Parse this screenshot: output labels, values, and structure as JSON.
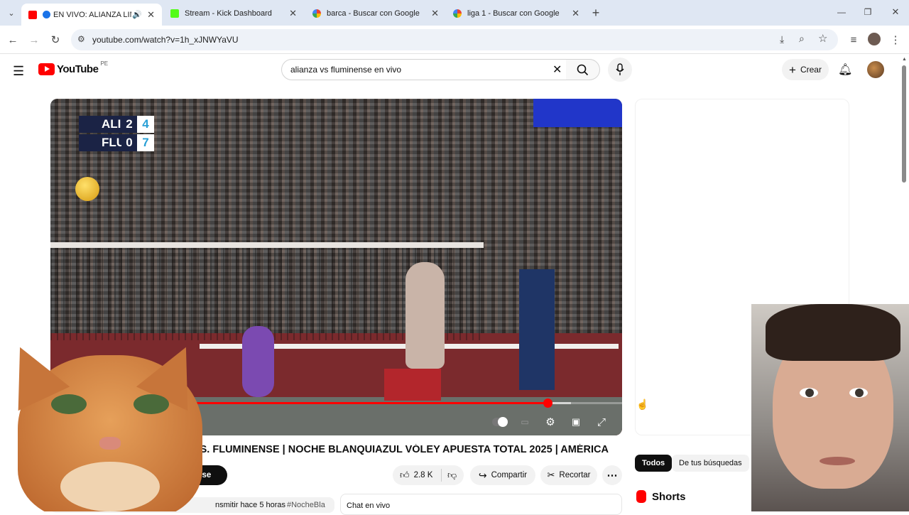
{
  "browser": {
    "tabs": [
      {
        "title": "EN VIVO: ALIANZA LIM",
        "active": true
      },
      {
        "title": "Stream - Kick Dashboard",
        "active": false
      },
      {
        "title": "barca - Buscar con Google",
        "active": false
      },
      {
        "title": "liga 1 - Buscar con Google",
        "active": false
      }
    ],
    "url": "youtube.com/watch?v=1h_xJNWYaVU",
    "new_tab_label": "+"
  },
  "youtube": {
    "logo_text": "YouTube",
    "region": "PE",
    "search_value": "alianza vs fluminense en vivo",
    "create_label": "Crear"
  },
  "player": {
    "scoreboard": [
      {
        "team": "ALI",
        "sets": "2",
        "points": "4"
      },
      {
        "team": "FLU",
        "sets": "0",
        "points": "7"
      }
    ],
    "progress_fraction": 0.87,
    "buffered_fraction": 0.91
  },
  "video": {
    "title": "A VS. FLUMINENSE | NOCHE BLANQUIAZUL VÓLEY APUESTA TOTAL 2025 | AMÉRICA",
    "subscribe_label": "dbirse",
    "likes": "2.8 K",
    "share_label": "Compartir",
    "clip_label": "Recortar",
    "description_start": "nsmitir hace 5 horas",
    "description_tag": "#NocheBla",
    "chat_label": "Chat en vivo"
  },
  "sidebar": {
    "chips": [
      "Todos",
      "De tus búsquedas"
    ],
    "shorts_label": "Shorts"
  },
  "colors": {
    "accent": "#ff0000",
    "chip_active_bg": "#0f0f0f",
    "score_points": "#2aa0d6"
  }
}
